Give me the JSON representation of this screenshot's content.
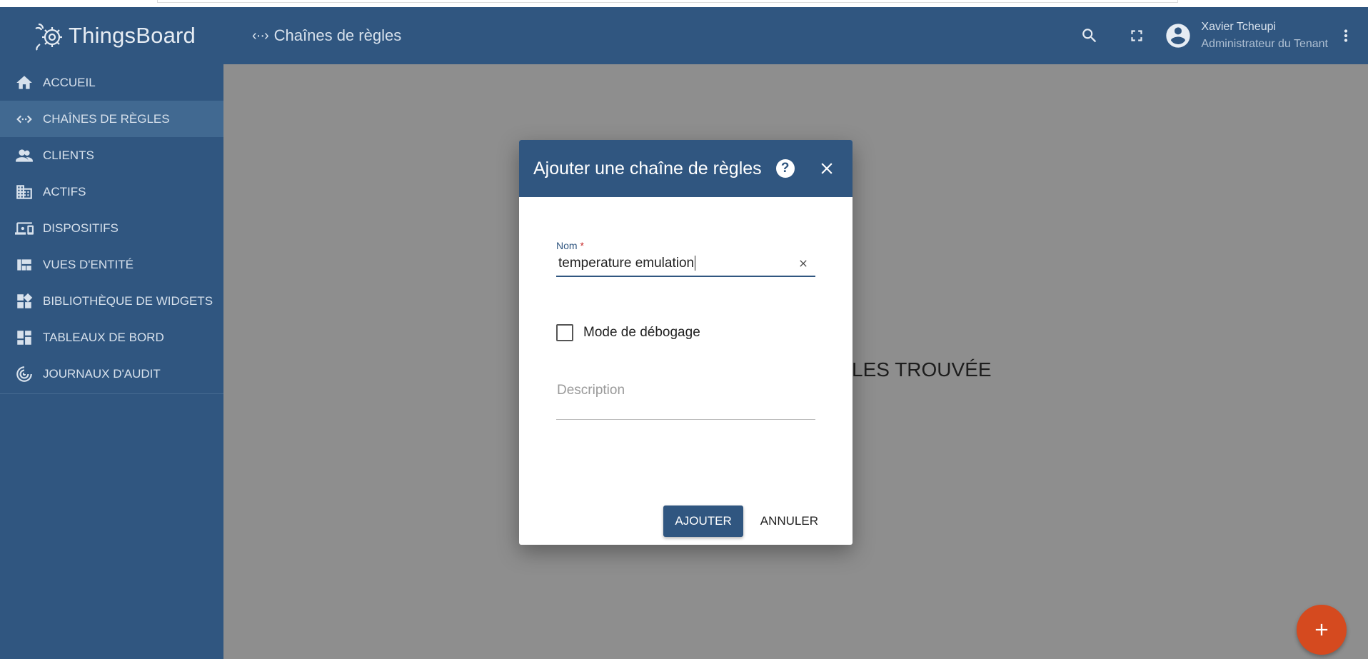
{
  "app": {
    "logo_text": "ThingsBoard"
  },
  "header": {
    "breadcrumb_icon": "‹··›",
    "breadcrumb_label": "Chaînes de règles",
    "user_name": "Xavier Tcheupi",
    "user_role": "Administrateur du Tenant"
  },
  "sidebar": {
    "items": [
      {
        "label": "ACCUEIL",
        "icon": "home-icon"
      },
      {
        "label": "CHAÎNES DE RÈGLES",
        "icon": "rule-chains-icon",
        "active": true
      },
      {
        "label": "CLIENTS",
        "icon": "clients-icon"
      },
      {
        "label": "ACTIFS",
        "icon": "assets-icon"
      },
      {
        "label": "DISPOSITIFS",
        "icon": "devices-icon"
      },
      {
        "label": "VUES D'ENTITÉ",
        "icon": "entity-views-icon"
      },
      {
        "label": "BIBLIOTHÈQUE DE WIDGETS",
        "icon": "widgets-library-icon"
      },
      {
        "label": "TABLEAUX DE BORD",
        "icon": "dashboards-icon"
      },
      {
        "label": "JOURNAUX D'AUDIT",
        "icon": "audit-logs-icon"
      }
    ]
  },
  "main": {
    "empty_message_visible": "LES TROUVÉE"
  },
  "dialog": {
    "title": "Ajouter une chaîne de règles",
    "help_glyph": "?",
    "name_label": "Nom",
    "name_required_mark": "*",
    "name_value": "temperature emulation",
    "debug_label": "Mode de débogage",
    "debug_checked": false,
    "description_placeholder": "Description",
    "add_label": "AJOUTER",
    "cancel_label": "ANNULER"
  },
  "colors": {
    "primary": "#305680",
    "sidebar_active": "#416991",
    "fab": "#d54a1f"
  }
}
